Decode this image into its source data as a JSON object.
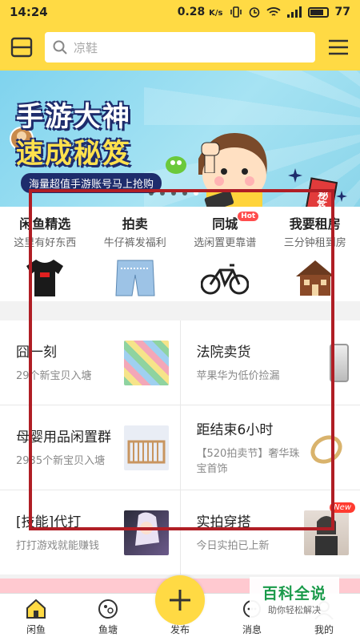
{
  "status": {
    "time": "14:24",
    "speed": "0.28",
    "speed_unit": "K/s",
    "battery": "77"
  },
  "search": {
    "placeholder": "凉鞋"
  },
  "banner": {
    "title1": "手游大神",
    "title2": "速成秘笈",
    "subtitle": "海量超值手游账号马上抢购",
    "book_text": "秘笈"
  },
  "categories": [
    {
      "title": "闲鱼精选",
      "subtitle": "这里有好东西",
      "icon": "tshirt-icon"
    },
    {
      "title": "拍卖",
      "subtitle": "牛仔裤发福利",
      "icon": "jeans-icon"
    },
    {
      "title": "同城",
      "subtitle": "选闲置更靠谱",
      "badge": "Hot",
      "icon": "bicycle-icon"
    },
    {
      "title": "我要租房",
      "subtitle": "三分钟租到房",
      "icon": "house-icon"
    }
  ],
  "tiles": [
    {
      "title": "囧一刻",
      "subtitle": "29个新宝贝入塘",
      "icon": "play-mat-thumb"
    },
    {
      "title": "法院卖货",
      "subtitle": "苹果华为低价捡漏",
      "icon": "phone-thumb"
    },
    {
      "title": "母婴用品闲置群",
      "subtitle": "2935个新宝贝入塘",
      "icon": "crib-thumb"
    },
    {
      "title": "距结束6小时",
      "subtitle": "【520拍卖节】奢华珠宝首饰",
      "icon": "ring-thumb"
    },
    {
      "title": "[技能]代打",
      "subtitle": "打打游戏就能赚钱",
      "icon": "anime-thumb"
    },
    {
      "title": "实拍穿搭",
      "subtitle": "今日实拍已上新",
      "badge": "New",
      "icon": "fashion-thumb"
    }
  ],
  "tabbar": [
    {
      "label": "闲鱼",
      "icon": "home-icon"
    },
    {
      "label": "鱼塘",
      "icon": "pond-icon"
    },
    {
      "label": "发布",
      "icon": "plus-icon"
    },
    {
      "label": "消息",
      "icon": "message-icon"
    },
    {
      "label": "我的",
      "icon": "profile-icon"
    }
  ],
  "watermark": {
    "title": "百科全说",
    "subtitle": "助你轻松解决"
  },
  "colors": {
    "brand_yellow": "#ffda44",
    "highlight_red": "#b01e25",
    "watermark_green": "#1a9a4a"
  }
}
